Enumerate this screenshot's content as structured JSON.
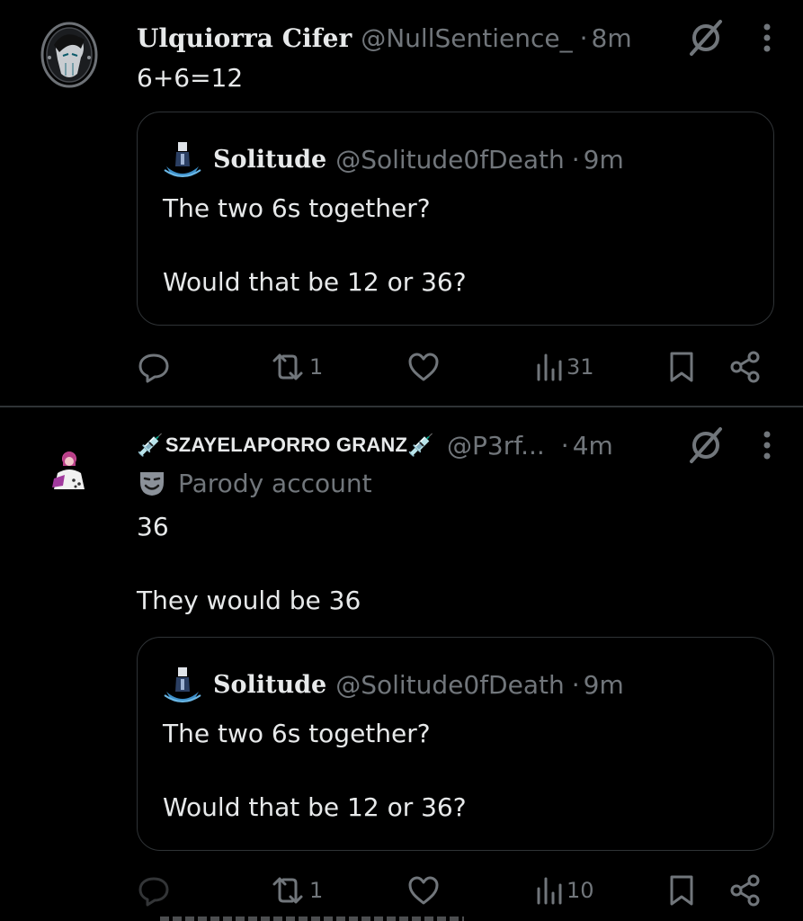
{
  "posts": [
    {
      "display_name": "Ulquiorra Cifer",
      "handle": "@NullSentience_",
      "separator": "·",
      "time": "8m",
      "avatar_icon": "gothic-portrait-avatar",
      "text": "6+6=12",
      "quote": {
        "display_name": "Solitude",
        "handle": "@Solitude0fDeath",
        "separator": "·",
        "time": "9m",
        "avatar_icon": "figure-avatar",
        "text_line_1": "The two 6s together?",
        "text_line_2": "Would that be 12 or 36?"
      },
      "actions": {
        "reply_count": "",
        "repost_count": "1",
        "like_count": "",
        "views_count": "31"
      }
    },
    {
      "display_name_prefix": "💉",
      "display_name": "SZAYELAPORRO GRANZ",
      "display_name_suffix": "💉",
      "handle": "@P3rf...",
      "separator": "·",
      "time": "4m",
      "avatar_icon": "pink-hair-character-avatar",
      "parody_label": "Parody account",
      "text_line_1": "36",
      "text_line_2": "They would be 36",
      "quote": {
        "display_name": "Solitude",
        "handle": "@Solitude0fDeath",
        "separator": "·",
        "time": "9m",
        "avatar_icon": "figure-avatar",
        "text_line_1": "The two 6s together?",
        "text_line_2": "Would that be 12 or 36?"
      },
      "actions": {
        "reply_count": "",
        "repost_count": "1",
        "like_count": "",
        "views_count": "10"
      }
    }
  ],
  "colors": {
    "background": "#000000",
    "text_primary": "#e7e9ea",
    "text_secondary": "#71767b",
    "border": "#2f3336"
  }
}
